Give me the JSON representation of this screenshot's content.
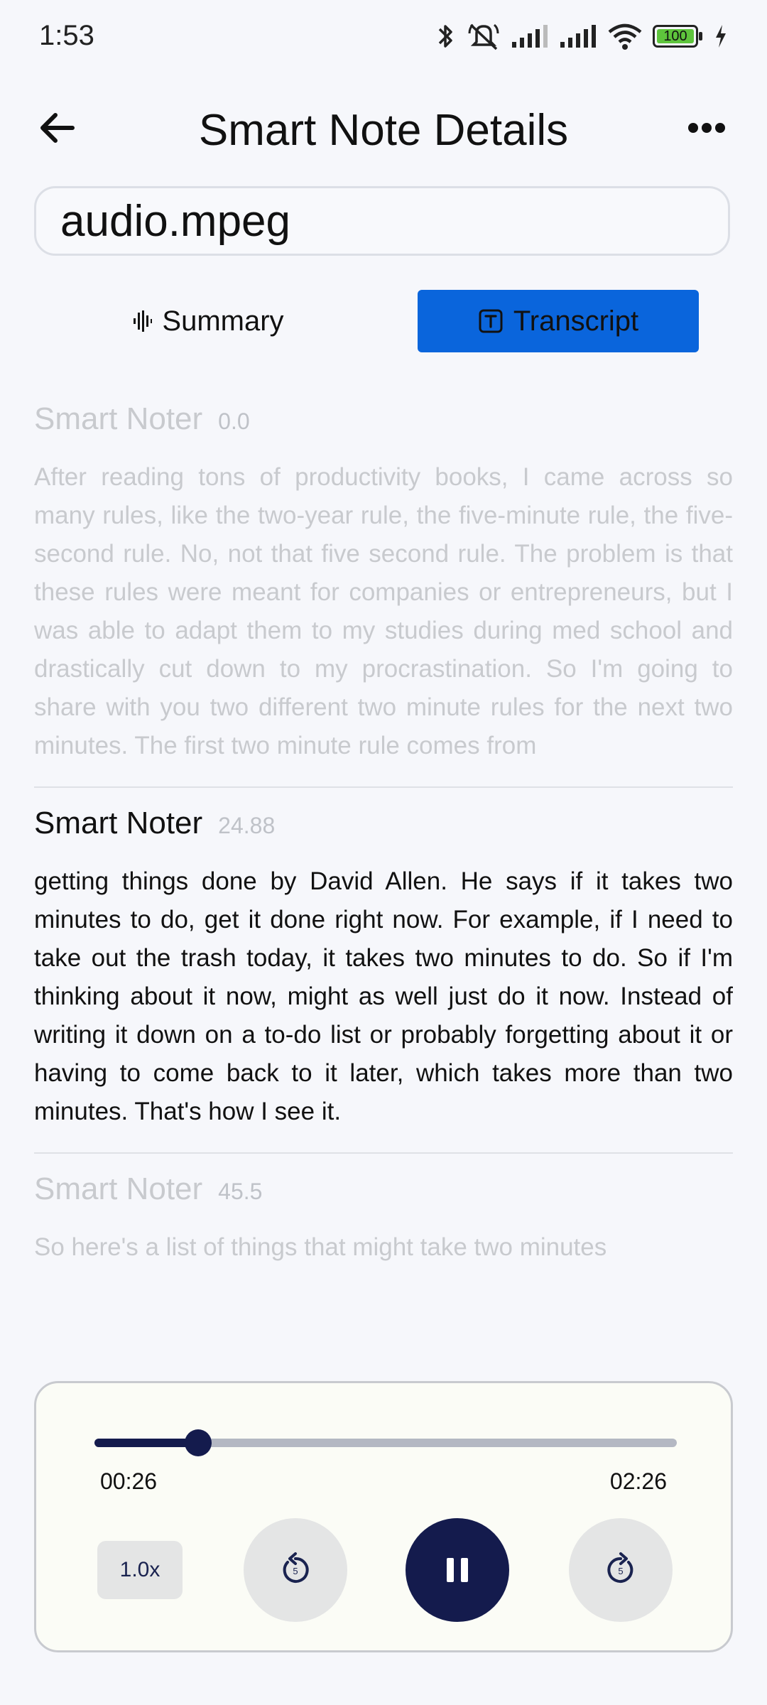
{
  "status_bar": {
    "time": "1:53",
    "battery_level": "100",
    "icons": [
      "bluetooth-icon",
      "muted-bell-icon",
      "signal-icon",
      "signal-icon",
      "wifi-icon",
      "battery-icon",
      "charging-icon"
    ]
  },
  "header": {
    "title": "Smart Note Details",
    "back_icon": "arrow-left-icon",
    "more_icon": "more-dots-icon"
  },
  "file": {
    "name": "audio.mpeg"
  },
  "tabs": [
    {
      "label": "Summary",
      "icon": "waveform-icon",
      "selected": false
    },
    {
      "label": "Transcript",
      "icon": "text-box-icon",
      "selected": true
    }
  ],
  "segments": [
    {
      "speaker": "Smart Noter",
      "time": "0.0",
      "text": "After reading tons of productivity books, I came across so many rules, like the two-year rule, the five-minute rule, the five-second rule. No, not that five second rule. The problem is that these rules were meant for companies or entrepreneurs, but I was able to adapt them to my studies during med school and drastically cut down to my procrastination. So I'm going to share with you two different two minute rules for the next two minutes. The first two minute rule comes from",
      "active": false
    },
    {
      "speaker": "Smart Noter",
      "time": "24.88",
      "text": "getting things done by David Allen. He says if it takes two minutes to do, get it done right now. For example, if I need to take out the trash today, it takes two minutes to do. So if I'm thinking about it now, might as well just do it now. Instead of writing it down on a to-do list or probably forgetting about it or having to come back to it later, which takes more than two minutes. That's how I see it.",
      "active": true
    },
    {
      "speaker": "Smart Noter",
      "time": "45.5",
      "text": "So here's a list of things that might take two minutes",
      "active": false
    }
  ],
  "player": {
    "current_time": "00:26",
    "total_time": "02:26",
    "progress_fraction": 0.178,
    "speed_label": "1.0x",
    "rewind_icon": "rewind-5-icon",
    "forward_icon": "forward-5-icon",
    "play_icon": "pause-icon",
    "skip_seconds": "5",
    "accent_color": "#141b4d",
    "tab_active_color": "#0a65dc"
  }
}
